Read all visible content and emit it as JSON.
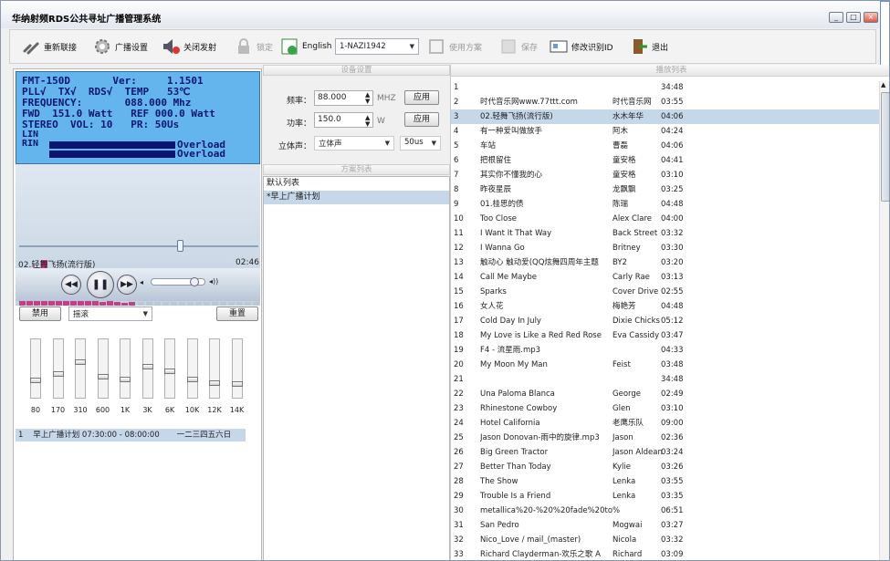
{
  "window": {
    "title": "华纳射频RDS公共寻址广播管理系统",
    "minimize": "_",
    "maximize": "□",
    "close": "×"
  },
  "toolbar": {
    "reconnect": "重新联接",
    "broadcast_settings": "广播设置",
    "shutdown_transmit": "关闭发射",
    "lock": "锁定",
    "english": "English",
    "device_select": "1-NAZI1942",
    "use_scheme": "使用方案",
    "save": "保存",
    "modify_id": "修改识别ID",
    "exit": "退出"
  },
  "lcd": {
    "line1": "FMT-150D       Ver:     1.1501",
    "line2": "PLL√  TX√  RDS√  TEMP   53℃",
    "line3": "FREQUENCY:       088.000 Mhz",
    "line4": "FWD  151.0 Watt   REF 000.0 Watt",
    "line5": "STEREO  VOL: 10   PR: 50Us",
    "lin": "LIN",
    "rin": "RIN",
    "lin_status": "Overload",
    "rin_status": "Overload"
  },
  "player": {
    "song": "02.轻舞飞扬(流行版)",
    "time": "02:46",
    "progress": 0.68
  },
  "eq": {
    "disable_label": "禁用",
    "preset": "摇滚",
    "reset_label": "重置",
    "bands": [
      "80",
      "170",
      "310",
      "600",
      "1K",
      "3K",
      "6K",
      "10K",
      "12K",
      "14K"
    ],
    "levels": [
      0.72,
      0.6,
      0.38,
      0.66,
      0.7,
      0.46,
      0.56,
      0.7,
      0.78,
      0.8
    ]
  },
  "schedule": {
    "row": "1    早上广播计划 07:30:00 - 08:00:00       一二三四五六日"
  },
  "device": {
    "header": "设备设置",
    "freq_label": "频率：",
    "freq_value": "88.000",
    "freq_unit": "MHZ",
    "power_label": "功率：",
    "power_value": "150.0",
    "power_unit": "W",
    "stereo_label": "立体声：",
    "stereo_value": "立体声",
    "preemph": "50us",
    "apply": "应用"
  },
  "schemes": {
    "header": "方案列表",
    "items": [
      "默认列表",
      "*早上广播计划"
    ]
  },
  "playlist": {
    "header": "播放列表",
    "selected": 3,
    "rows": [
      [
        "1",
        "",
        "34:48"
      ],
      [
        "2",
        "时代音乐网www.77ttt.com",
        "时代音乐网",
        "03:55"
      ],
      [
        "3",
        "02.轻舞飞扬(流行版)",
        "水木年华",
        "04:06"
      ],
      [
        "4",
        "有一种爱叫做放手",
        "阿木",
        "04:24"
      ],
      [
        "5",
        "车站",
        "曹磊",
        "04:06"
      ],
      [
        "6",
        "把根留住",
        "童安格",
        "04:41"
      ],
      [
        "7",
        "其实你不懂我的心",
        "童安格",
        "03:10"
      ],
      [
        "8",
        "昨夜星辰",
        "龙飘飘",
        "03:25"
      ],
      [
        "9",
        "01.桂思的债",
        "陈瑞",
        "04:48"
      ],
      [
        "10",
        "Too Close",
        "Alex Clare",
        "04:00"
      ],
      [
        "11",
        "I Want It That Way",
        "Back Street",
        "03:32"
      ],
      [
        "12",
        "I Wanna Go",
        "Britney",
        "03:30"
      ],
      [
        "13",
        "触动心 触动爱(QQ炫舞四周年主题",
        "BY2",
        "03:20"
      ],
      [
        "14",
        "Call Me Maybe",
        "Carly Rae",
        "03:13"
      ],
      [
        "15",
        "Sparks",
        "Cover Drive",
        "02:55"
      ],
      [
        "16",
        "女人花",
        "梅艳芳",
        "04:48"
      ],
      [
        "17",
        "Cold Day In July",
        "Dixie Chicks",
        "05:12"
      ],
      [
        "18",
        "My Love is Like a Red Red Rose",
        "Eva Cassidy",
        "03:47"
      ],
      [
        "19",
        "F4 - 流星雨.mp3",
        "",
        "04:33"
      ],
      [
        "20",
        "My Moon My Man",
        "Feist",
        "03:48"
      ],
      [
        "21",
        "",
        "",
        "34:48"
      ],
      [
        "22",
        "Una Paloma Blanca",
        "George",
        "02:49"
      ],
      [
        "23",
        "Rhinestone Cowboy",
        "Glen",
        "03:10"
      ],
      [
        "24",
        "Hotel California",
        "老鹰乐队",
        "09:00"
      ],
      [
        "25",
        "Jason Donovan-雨中的旋律.mp3",
        "Jason",
        "02:36"
      ],
      [
        "26",
        "Big Green Tractor",
        "Jason Aldean",
        "03:24"
      ],
      [
        "27",
        "Better Than Today",
        "Kylie",
        "03:26"
      ],
      [
        "28",
        "The Show",
        "Lenka",
        "03:55"
      ],
      [
        "29",
        "Trouble Is a Friend",
        "Lenka",
        "03:35"
      ],
      [
        "30",
        "metallica%20-%20%20fade%20to%",
        "",
        "06:51"
      ],
      [
        "31",
        "San Pedro",
        "Mogwai",
        "03:27"
      ],
      [
        "32",
        "Nico_Love / mail_(master)",
        "Nicola",
        "03:32"
      ],
      [
        "33",
        "Richard Clayderman-欢乐之歌 A",
        "Richard",
        "03:09"
      ]
    ]
  }
}
